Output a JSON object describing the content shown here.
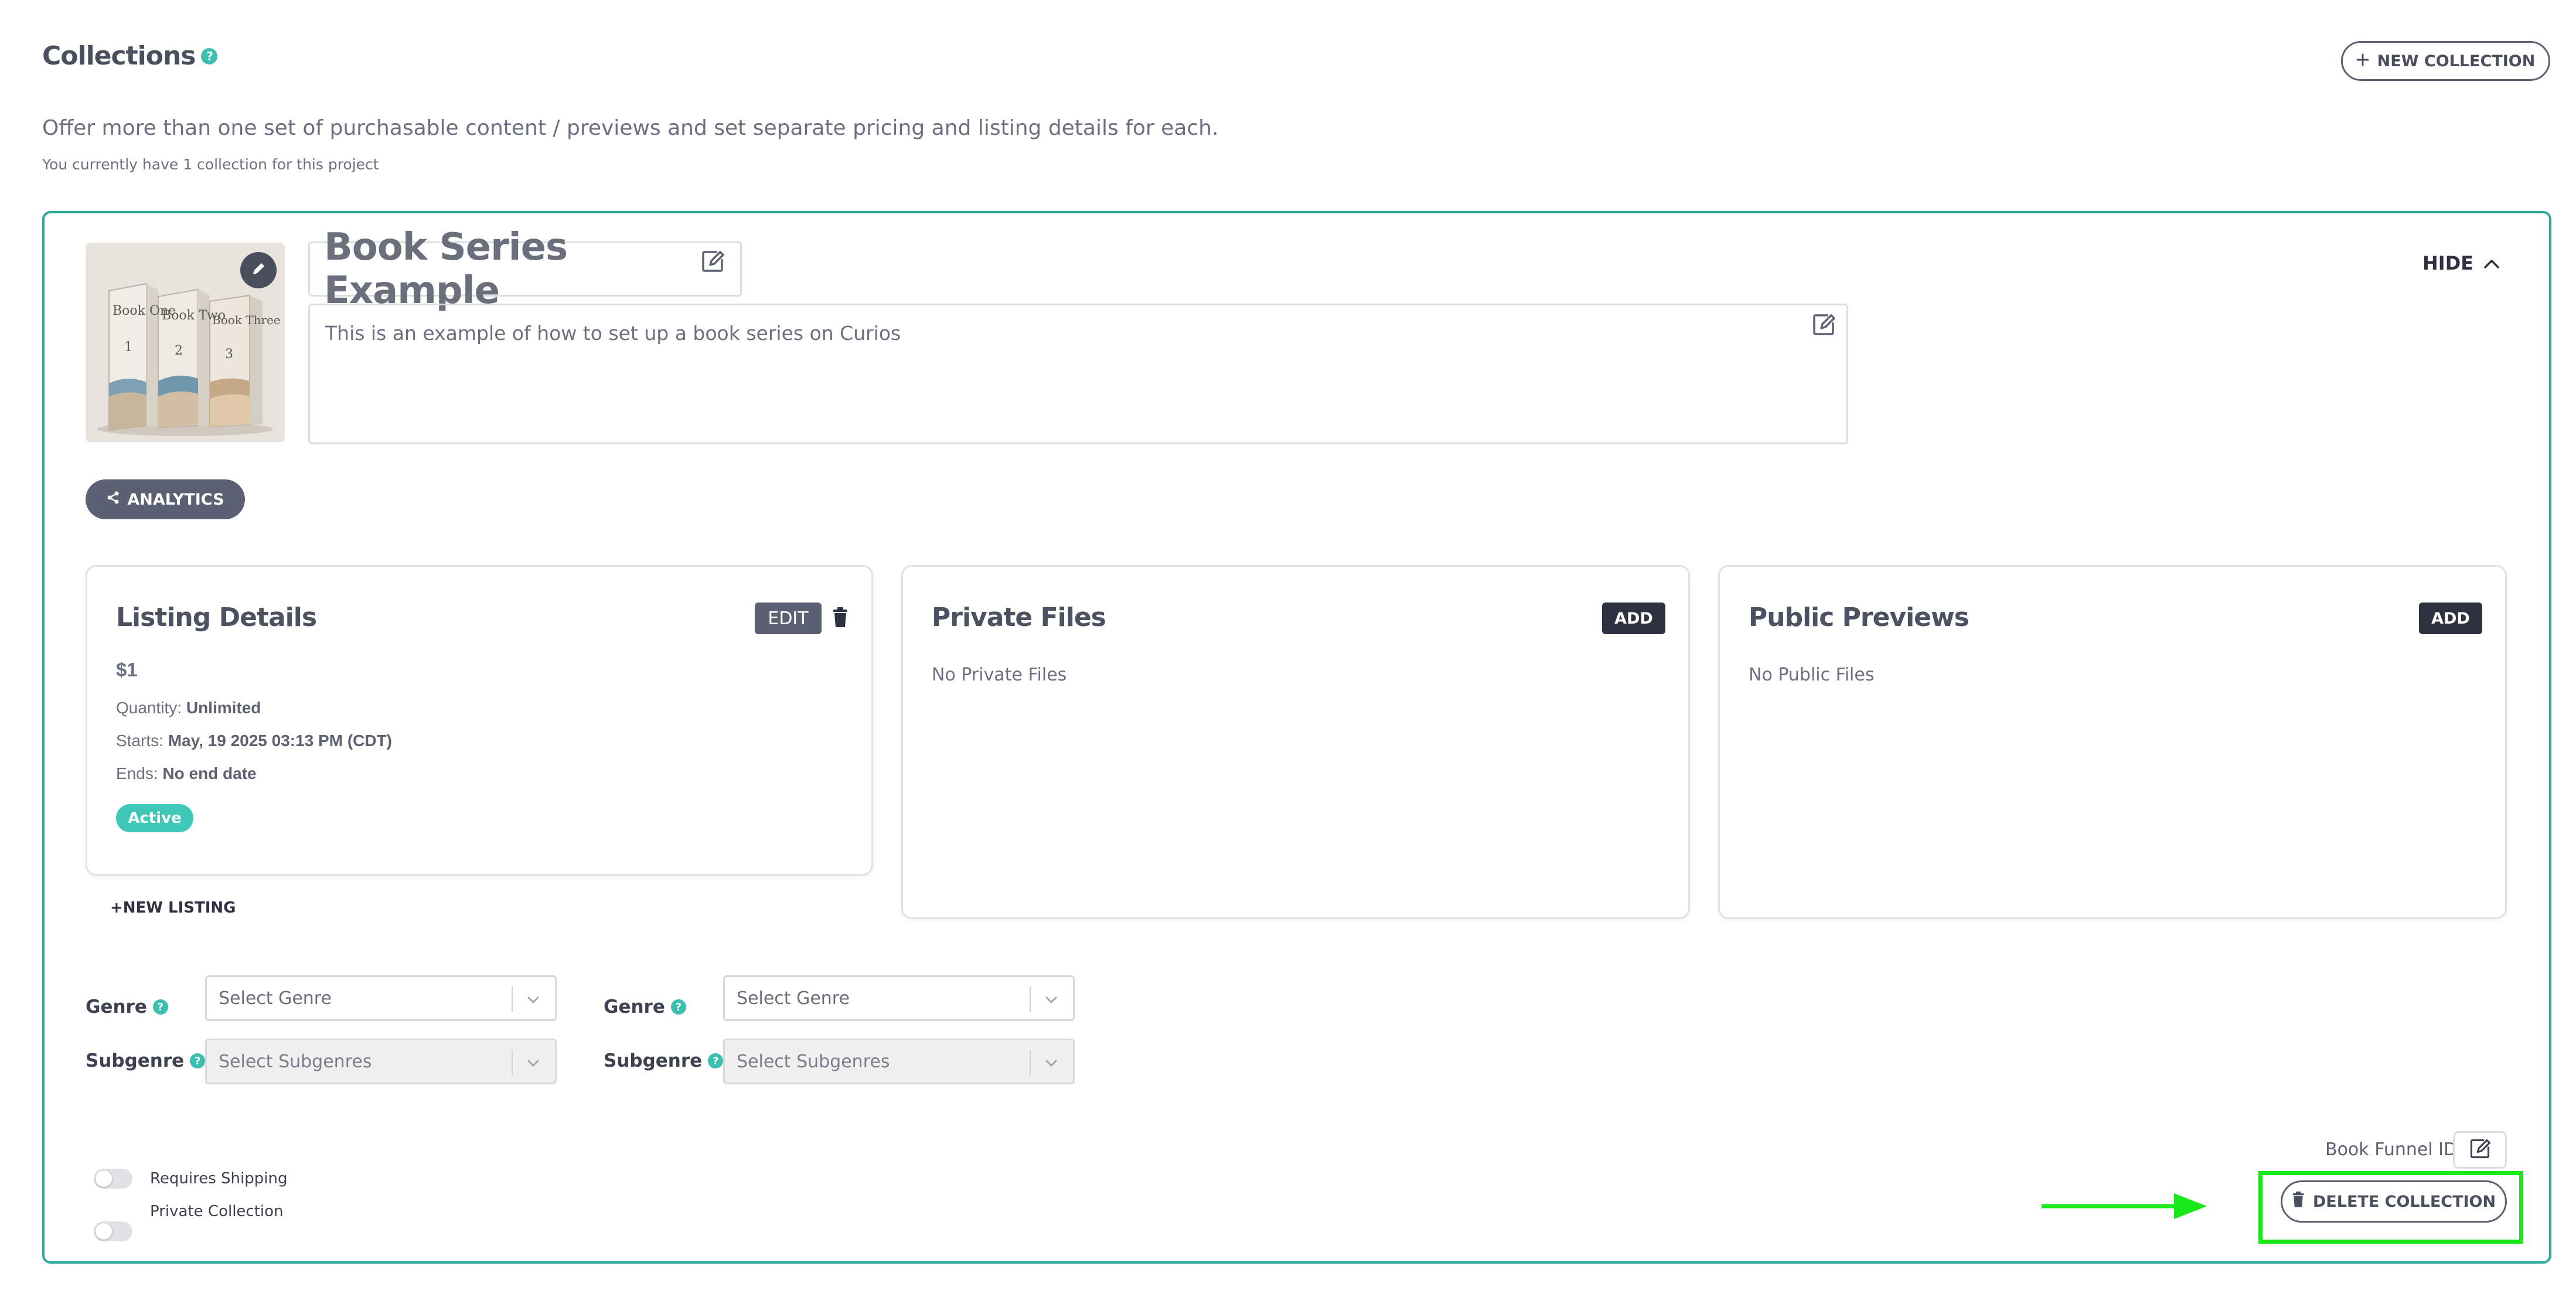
{
  "header": {
    "title": "Collections",
    "help": "?",
    "new_collection_label": "NEW COLLECTION",
    "subtitle": "Offer more than one set of purchasable content / previews and set separate pricing and listing details for each.",
    "count_text": "You currently have 1 collection for this project"
  },
  "collection": {
    "name": "Book Series Example",
    "description": "This is an example of how to set up a book series on Curios",
    "hide_label": "HIDE",
    "analytics_label": "ANALYTICS",
    "cover_books": [
      "Book One",
      "Book Two",
      "Book Three"
    ],
    "cover_numbers": [
      "1",
      "2",
      "3"
    ]
  },
  "listing": {
    "title": "Listing Details",
    "edit_label": "EDIT",
    "price": "$1",
    "quantity_label": "Quantity:",
    "quantity_value": "Unlimited",
    "starts_label": "Starts:",
    "starts_value": "May, 19 2025 03:13 PM (CDT)",
    "ends_label": "Ends:",
    "ends_value": "No end date",
    "status": "Active",
    "new_listing_label": "+NEW LISTING"
  },
  "private_files": {
    "title": "Private Files",
    "add_label": "ADD",
    "empty": "No Private Files"
  },
  "public_previews": {
    "title": "Public Previews",
    "add_label": "ADD",
    "empty": "No Public Files"
  },
  "genres": {
    "genre_label": "Genre",
    "subgenre_label": "Subgenre",
    "genre_placeholder": "Select Genre",
    "subgenre_placeholder": "Select Subgenres"
  },
  "options": {
    "requires_shipping": "Requires Shipping",
    "private_collection": "Private Collection",
    "requires_shipping_on": false,
    "private_collection_on": false
  },
  "footer": {
    "funnel_label": "Book Funnel ID:",
    "delete_label": "DELETE COLLECTION"
  },
  "colors": {
    "accent_teal": "#2fa89a",
    "highlight_green": "#18e81a",
    "dark_button": "#2d3140"
  }
}
